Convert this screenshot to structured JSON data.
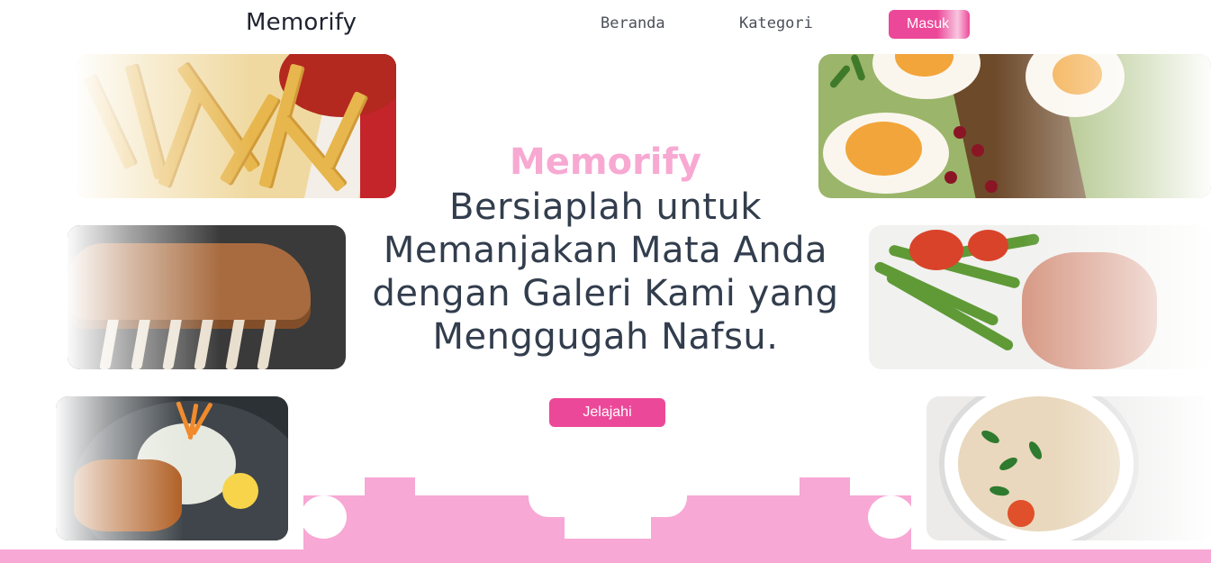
{
  "nav": {
    "brand": "Memorify",
    "links": [
      {
        "label": "Beranda"
      },
      {
        "label": "Kategori"
      }
    ],
    "login_label": "Masuk"
  },
  "hero": {
    "brand": "Memorify",
    "heading": "Bersiaplah untuk Memanjakan Mata Anda dengan Galeri Kami yang Menggugah Nafsu.",
    "cta_label": "Jelajahi"
  },
  "colors": {
    "accent": "#ec4899",
    "accent_light": "#f7a8d4",
    "heading": "#323d4d"
  },
  "gallery": [
    {
      "name": "fries-photo"
    },
    {
      "name": "eggs-avocado-toast-photo"
    },
    {
      "name": "grilled-ribs-photo"
    },
    {
      "name": "asparagus-salmon-photo"
    },
    {
      "name": "chicken-salad-bowl-photo"
    },
    {
      "name": "pho-soup-photo"
    }
  ]
}
